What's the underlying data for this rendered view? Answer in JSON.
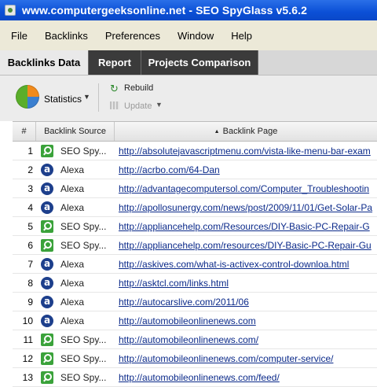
{
  "window": {
    "title": "www.computergeeksonline.net - SEO SpyGlass v5.6.2"
  },
  "menu": [
    "File",
    "Backlinks",
    "Preferences",
    "Window",
    "Help"
  ],
  "tabs": [
    {
      "label": "Backlinks Data",
      "active": true
    },
    {
      "label": "Report",
      "active": false
    },
    {
      "label": "Projects Comparison",
      "active": false
    }
  ],
  "toolbar": {
    "statistics_label": "Statistics",
    "rebuild_label": "Rebuild",
    "update_label": "Update"
  },
  "table": {
    "headers": {
      "num": "#",
      "source": "Backlink Source",
      "page": "Backlink Page"
    },
    "rows": [
      {
        "num": "1",
        "source": "SEO Spy...",
        "source_icon": "seo-spyglass-icon",
        "page": "http://absolutejavascriptmenu.com/vista-like-menu-bar-exam"
      },
      {
        "num": "2",
        "source": "Alexa",
        "source_icon": "alexa-icon",
        "page": "http://acrbo.com/64-Dan"
      },
      {
        "num": "3",
        "source": "Alexa",
        "source_icon": "alexa-icon",
        "page": "http://advantagecomputersol.com/Computer_Troubleshootin"
      },
      {
        "num": "4",
        "source": "Alexa",
        "source_icon": "alexa-icon",
        "page": "http://apollosunergy.com/news/post/2009/11/01/Get-Solar-Pa"
      },
      {
        "num": "5",
        "source": "SEO Spy...",
        "source_icon": "seo-spyglass-icon",
        "page": "http://appliancehelp.com/Resources/DIY-Basic-PC-Repair-G"
      },
      {
        "num": "6",
        "source": "SEO Spy...",
        "source_icon": "seo-spyglass-icon",
        "page": "http://appliancehelp.com/resources/DIY-Basic-PC-Repair-Gu"
      },
      {
        "num": "7",
        "source": "Alexa",
        "source_icon": "alexa-icon",
        "page": "http://askives.com/what-is-activex-control-downloa.html"
      },
      {
        "num": "8",
        "source": "Alexa",
        "source_icon": "alexa-icon",
        "page": "http://asktcl.com/links.html"
      },
      {
        "num": "9",
        "source": "Alexa",
        "source_icon": "alexa-icon",
        "page": "http://autocarslive.com/2011/06"
      },
      {
        "num": "10",
        "source": "Alexa",
        "source_icon": "alexa-icon",
        "page": "http://automobileonlinenews.com"
      },
      {
        "num": "11",
        "source": "SEO Spy...",
        "source_icon": "seo-spyglass-icon",
        "page": "http://automobileonlinenews.com/"
      },
      {
        "num": "12",
        "source": "SEO Spy...",
        "source_icon": "seo-spyglass-icon",
        "page": "http://automobileonlinenews.com/computer-service/"
      },
      {
        "num": "13",
        "source": "SEO Spy...",
        "source_icon": "seo-spyglass-icon",
        "page": "http://automobileonlinenews.com/feed/"
      }
    ]
  }
}
